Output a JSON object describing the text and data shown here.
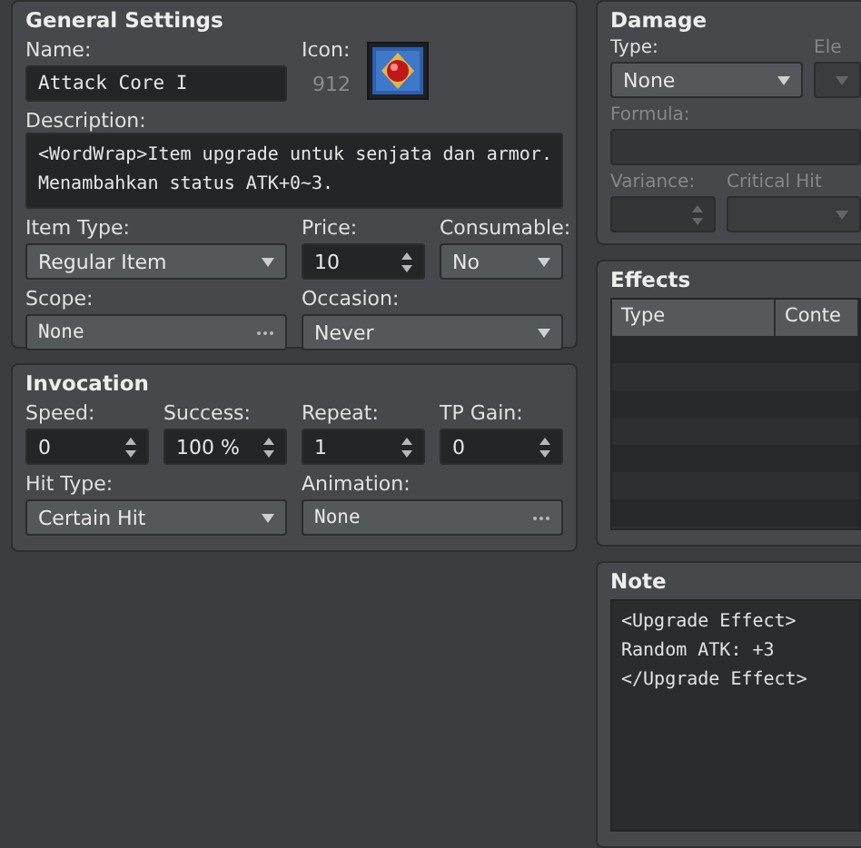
{
  "general_settings": {
    "title": "General Settings",
    "name": {
      "label": "Name:",
      "value": "Attack Core I"
    },
    "icon": {
      "label": "Icon:",
      "index": "912"
    },
    "description": {
      "label": "Description:",
      "value": "<WordWrap>Item upgrade untuk senjata dan armor.\nMenambahkan status ATK+0~3."
    },
    "fields": [
      {
        "kind": "select",
        "label": "Item Type:",
        "value": "Regular Item"
      },
      {
        "kind": "spin",
        "label": "Price:",
        "value": "10"
      },
      {
        "kind": "select",
        "label": "Consumable:",
        "value": "No"
      },
      {
        "kind": "picker",
        "label": "Scope:",
        "value": "None"
      },
      {
        "kind": "select",
        "label": "Occasion:",
        "value": "Never"
      }
    ]
  },
  "invocation": {
    "title": "Invocation",
    "fields": [
      {
        "kind": "spin",
        "label": "Speed:",
        "value": "0"
      },
      {
        "kind": "spin",
        "label": "Success:",
        "value": "100 %"
      },
      {
        "kind": "spin",
        "label": "Repeat:",
        "value": "1"
      },
      {
        "kind": "spin",
        "label": "TP Gain:",
        "value": "0"
      },
      {
        "kind": "select",
        "label": "Hit Type:",
        "value": "Certain Hit"
      },
      {
        "kind": "picker",
        "label": "Animation:",
        "value": "None"
      }
    ]
  },
  "damage": {
    "title": "Damage",
    "fields": [
      {
        "kind": "select",
        "label": "Type:",
        "value": "None",
        "disabled": false
      },
      {
        "kind": "select",
        "label": "Ele",
        "disabled": true
      },
      {
        "kind": "text",
        "label": "Formula:",
        "disabled": true
      },
      {
        "kind": "spin",
        "label": "Variance:",
        "disabled": true
      },
      {
        "kind": "select",
        "label": "Critical Hit",
        "disabled": true
      }
    ]
  },
  "effects": {
    "title": "Effects",
    "columns": [
      "Type",
      "Conte"
    ]
  },
  "note": {
    "title": "Note",
    "value": "<Upgrade Effect>\nRandom ATK: +3\n</Upgrade Effect>"
  }
}
